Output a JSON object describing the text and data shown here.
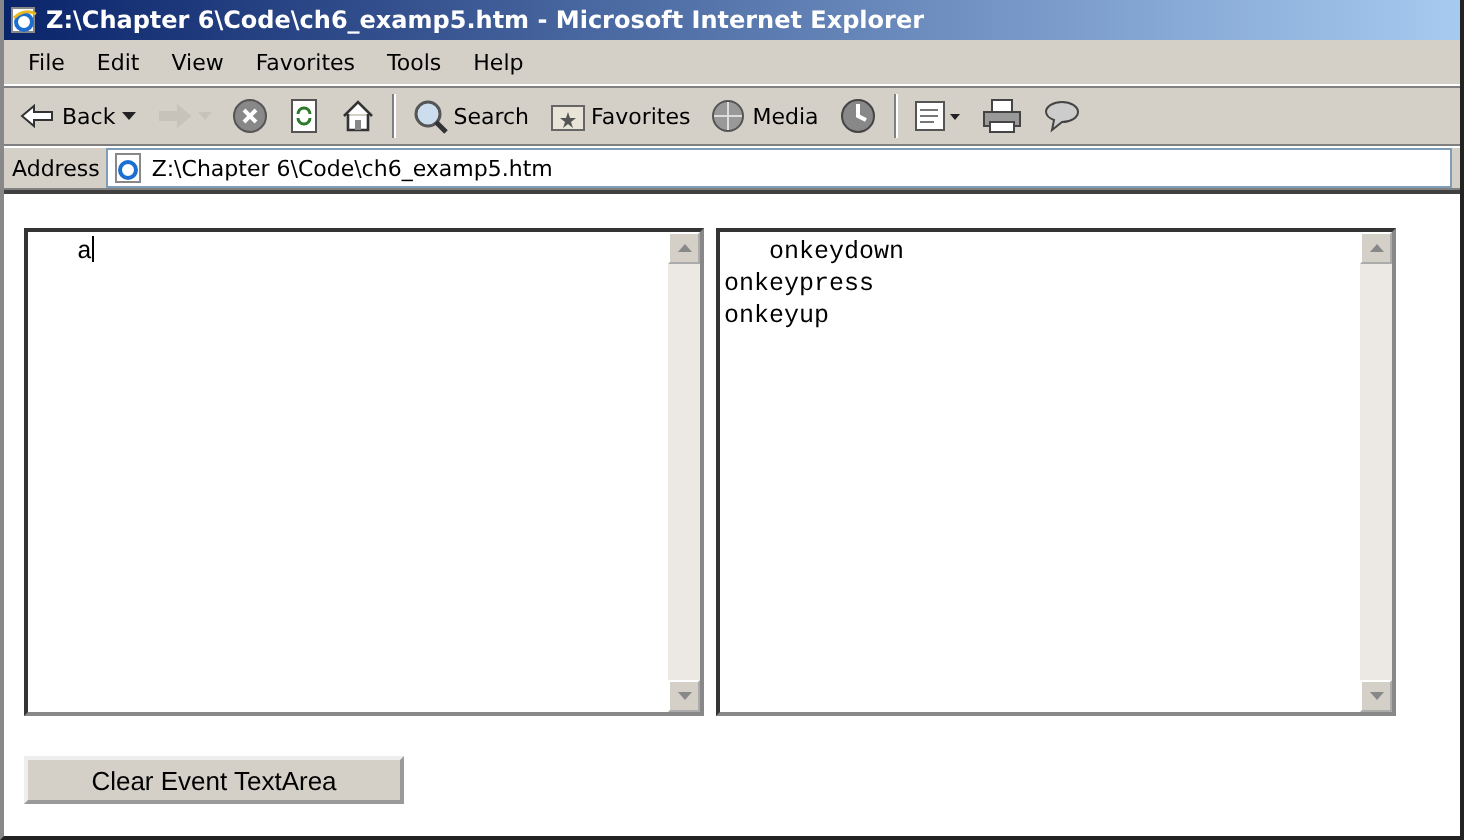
{
  "window": {
    "title": "Z:\\Chapter 6\\Code\\ch6_examp5.htm - Microsoft Internet Explorer"
  },
  "menu": [
    "File",
    "Edit",
    "View",
    "Favorites",
    "Tools",
    "Help"
  ],
  "toolbar": [
    {
      "kind": "back",
      "label": "Back",
      "disabled": false
    },
    {
      "kind": "forward",
      "disabled": true
    },
    {
      "kind": "stop",
      "disabled": false
    },
    {
      "kind": "refresh",
      "disabled": false
    },
    {
      "kind": "home",
      "disabled": false
    },
    {
      "kind": "sep"
    },
    {
      "kind": "search",
      "label": "Search",
      "disabled": false
    },
    {
      "kind": "favorites",
      "label": "Favorites",
      "disabled": false
    },
    {
      "kind": "media",
      "label": "Media",
      "disabled": false
    },
    {
      "kind": "history",
      "disabled": false
    },
    {
      "kind": "sep"
    },
    {
      "kind": "mail",
      "disabled": false
    },
    {
      "kind": "print",
      "disabled": false
    },
    {
      "kind": "discuss",
      "disabled": false
    }
  ],
  "address": {
    "label": "Address",
    "value": "Z:\\Chapter 6\\Code\\ch6_examp5.htm"
  },
  "key_input": {
    "value": "   a"
  },
  "event_log": {
    "lines": [
      "   onkeydown",
      "onkeypress",
      "onkeyup"
    ]
  },
  "button": {
    "label": "Clear Event TextArea"
  }
}
